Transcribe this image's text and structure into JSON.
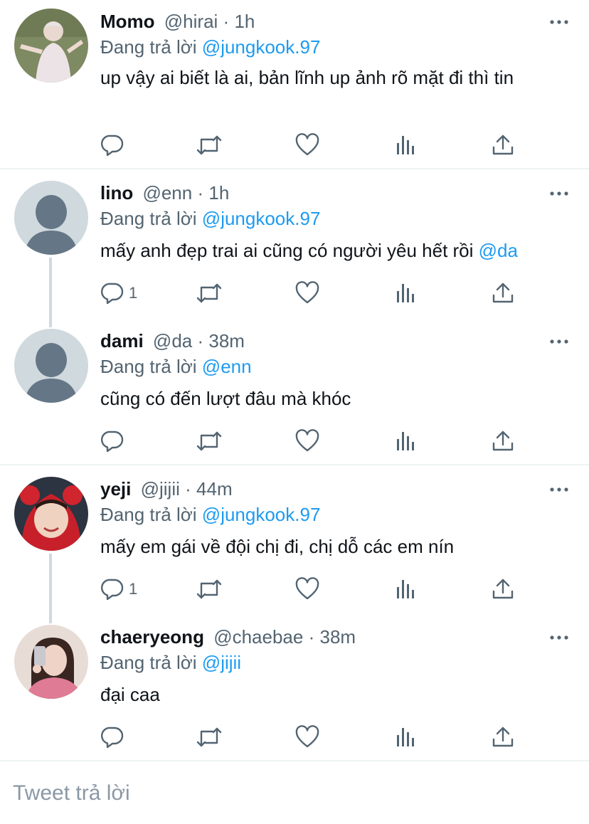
{
  "reply_prefix": "Đang trả lời",
  "tweets": [
    {
      "name": "Momo",
      "handle": "@hirai",
      "sep": "·",
      "time": "1h",
      "reply_to": "@jungkook.97",
      "text": "up vậy ai biết là ai, bản lĩnh up ảnh rõ mặt đi thì tin",
      "text_mention": "",
      "reply_count": ""
    },
    {
      "name": "lino",
      "handle": "@enn",
      "sep": "·",
      "time": "1h",
      "reply_to": "@jungkook.97",
      "text": "mấy anh đẹp trai ai cũng có người yêu hết rồi ",
      "text_mention": "@da",
      "reply_count": "1"
    },
    {
      "name": "dami",
      "handle": "@da",
      "sep": "·",
      "time": "38m",
      "reply_to": "@enn",
      "text": "cũng có đến lượt đâu mà khóc",
      "text_mention": "",
      "reply_count": ""
    },
    {
      "name": "yeji",
      "handle": "@jijii",
      "sep": "·",
      "time": "44m",
      "reply_to": "@jungkook.97",
      "text": "mấy em gái về đội chị đi, chị dỗ các em nín",
      "text_mention": "",
      "reply_count": "1"
    },
    {
      "name": "chaeryeong",
      "handle": "@chaebae",
      "sep": "·",
      "time": "38m",
      "reply_to": "@jijii",
      "text": "đại caa",
      "text_mention": "",
      "reply_count": ""
    }
  ],
  "icons": {
    "reply": "reply-icon",
    "retweet": "retweet-icon",
    "like": "heart-icon",
    "analytics": "analytics-icon",
    "share": "share-icon",
    "more": "more-icon"
  },
  "composer": {
    "placeholder": "Tweet trả lời"
  },
  "colors": {
    "accent": "#1d9bf0",
    "text": "#0f1419",
    "muted": "#536471",
    "divider": "#eff3f4",
    "thread": "#cfd9de"
  }
}
